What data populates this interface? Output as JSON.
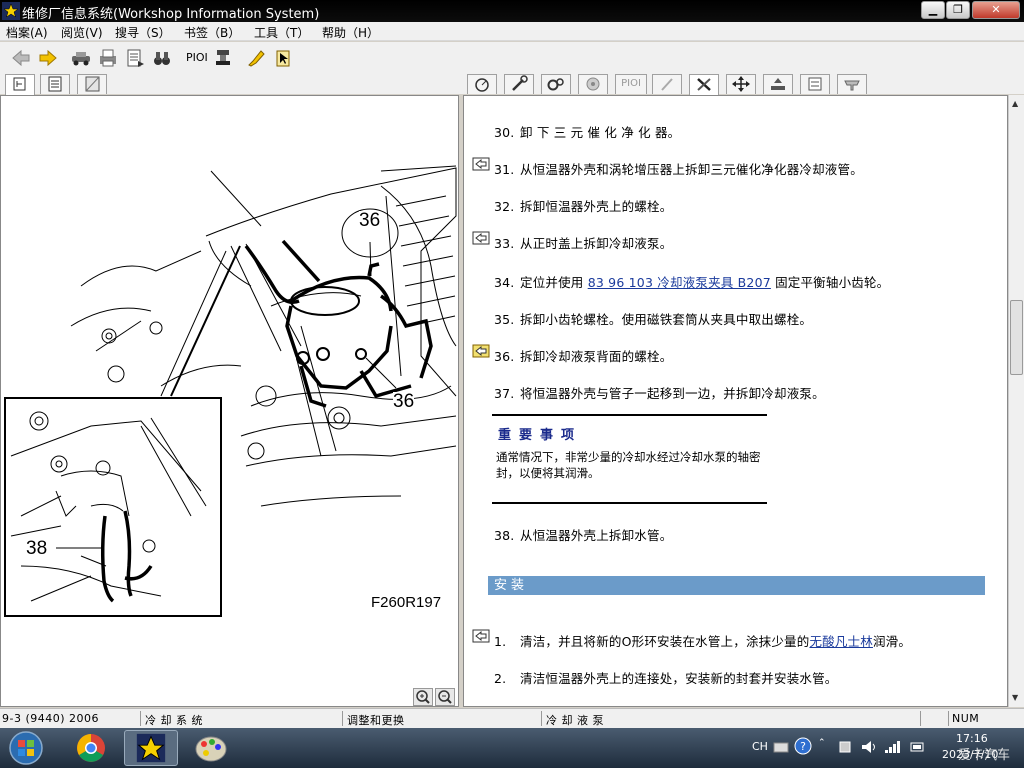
{
  "window": {
    "title": "维修厂信息系统(Workshop Information System)",
    "min": "▁",
    "max": "❐",
    "close": "✕"
  },
  "menu": [
    "档案(A)",
    "阅览(V)",
    "搜寻（S）",
    "书签（B）",
    "工具（T）",
    "帮助（H）"
  ],
  "toolbar": {
    "pioi": "PIOI"
  },
  "right_tabs": {
    "pioi": "PIOI"
  },
  "figure": {
    "code": "F260R197",
    "callout_top": "36",
    "callout_bottom": "36",
    "callout_inset": "38"
  },
  "steps": [
    {
      "num": "30.",
      "text": "卸 下 三 元 催 化 净 化 器。"
    },
    {
      "num": "31.",
      "text": "从恒温器外壳和涡轮增压器上拆卸三元催化净化器冷却液管。"
    },
    {
      "num": "32.",
      "text": "拆卸恒温器外壳上的螺栓。"
    },
    {
      "num": "33.",
      "text": "从正时盖上拆卸冷却液泵。"
    },
    {
      "num": "34.",
      "pre": "定位并使用 ",
      "link": "83 96 103 冷却液泵夹具 B207",
      "post": " 固定平衡轴小齿轮。"
    },
    {
      "num": "35.",
      "text": "拆卸小齿轮螺栓。使用磁铁套筒从夹具中取出螺栓。"
    },
    {
      "num": "36.",
      "text": "拆卸冷却液泵背面的螺栓。"
    },
    {
      "num": "37.",
      "text": "将恒温器外壳与管子一起移到一边，并拆卸冷却液泵。"
    },
    {
      "num": "38.",
      "text": "从恒温器外壳上拆卸水管。"
    }
  ],
  "note": {
    "title": "重要事项",
    "body": "通常情况下，非常少量的冷却水经过冷却水泵的轴密封，以便将其润滑。"
  },
  "section_title": "安装",
  "install_steps": [
    {
      "num": "1.",
      "pre": "清洁，并且将新的O形环安装在水管上，涂抹少量的",
      "link": "无酸凡士林",
      "post": "润滑。"
    },
    {
      "num": "2.",
      "text": "清洁恒温器外壳上的连接处，安装新的封套并安装水管。"
    }
  ],
  "status": {
    "model": "9-3 (9440) 2006",
    "system": "冷 却 系 统",
    "section": "调整和更换",
    "component": "冷 却 液 泵",
    "num": "NUM"
  },
  "tray": {
    "lang": "CH",
    "time": "17:16",
    "date": "2023/7/10",
    "watermark": "爱卡汽车"
  }
}
